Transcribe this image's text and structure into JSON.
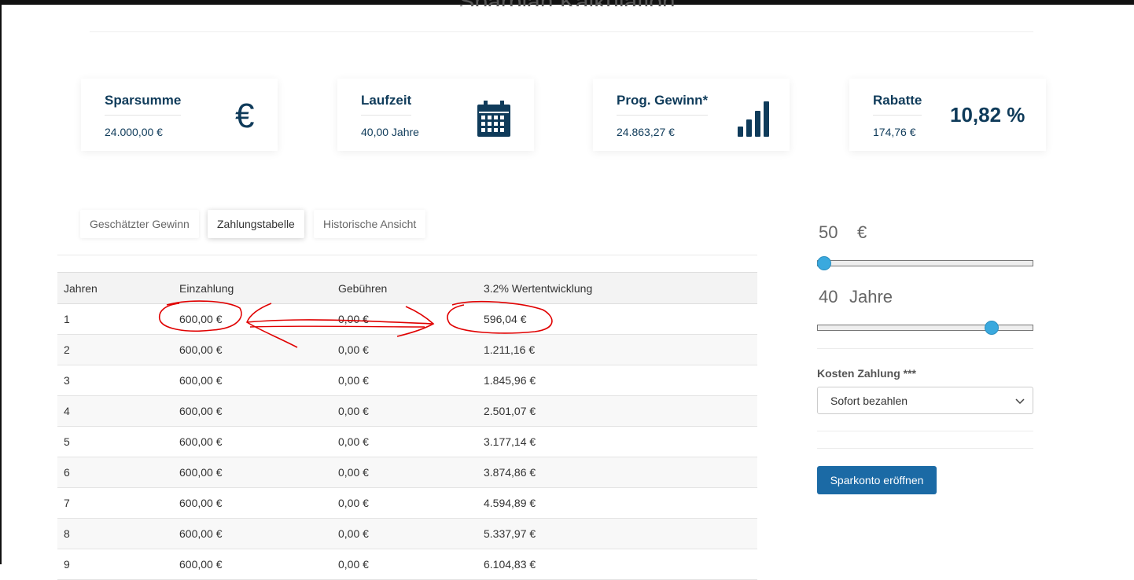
{
  "page": {
    "title": "Sparplan Kalkulation"
  },
  "cards": [
    {
      "label": "Sparsumme",
      "value": "24.000,00 €",
      "icon": "euro-icon"
    },
    {
      "label": "Laufzeit",
      "value": "40,00 Jahre",
      "icon": "calendar-icon"
    },
    {
      "label": "Prog. Gewinn*",
      "value": "24.863,27 €",
      "icon": "bar-chart-icon"
    },
    {
      "label": "Rabatte",
      "value": "174,76 €",
      "percent": "10,82 %"
    }
  ],
  "tabs": [
    {
      "label": "Geschätzter Gewinn",
      "active": false
    },
    {
      "label": "Zahlungstabelle",
      "active": true
    },
    {
      "label": "Historische Ansicht",
      "active": false
    }
  ],
  "table": {
    "headers": [
      "Jahren",
      "Einzahlung",
      "Gebühren",
      "3.2% Wertentwicklung"
    ],
    "rows": [
      [
        "1",
        "600,00 €",
        "0,00 €",
        "596,04 €"
      ],
      [
        "2",
        "600,00 €",
        "0,00 €",
        "1.211,16 €"
      ],
      [
        "3",
        "600,00 €",
        "0,00 €",
        "1.845,96 €"
      ],
      [
        "4",
        "600,00 €",
        "0,00 €",
        "2.501,07 €"
      ],
      [
        "5",
        "600,00 €",
        "0,00 €",
        "3.177,14 €"
      ],
      [
        "6",
        "600,00 €",
        "0,00 €",
        "3.874,86 €"
      ],
      [
        "7",
        "600,00 €",
        "0,00 €",
        "4.594,89 €"
      ],
      [
        "8",
        "600,00 €",
        "0,00 €",
        "5.337,97 €"
      ],
      [
        "9",
        "600,00 €",
        "0,00 €",
        "6.104,83 €"
      ]
    ]
  },
  "sidebar": {
    "amount": "50",
    "amount_unit": "€",
    "amount_slider_fraction": 0.0,
    "years": "40",
    "years_unit": "Jahre",
    "years_slider_fraction": 0.83,
    "cost_label": "Kosten Zahlung ***",
    "cost_selected": "Sofort bezahlen",
    "open_button": "Sparkonto eröffnen"
  },
  "colors": {
    "brand": "#0f3b5a",
    "button": "#1b6aa5",
    "slider_thumb": "#3aa9de",
    "annotation": "#e00000"
  }
}
